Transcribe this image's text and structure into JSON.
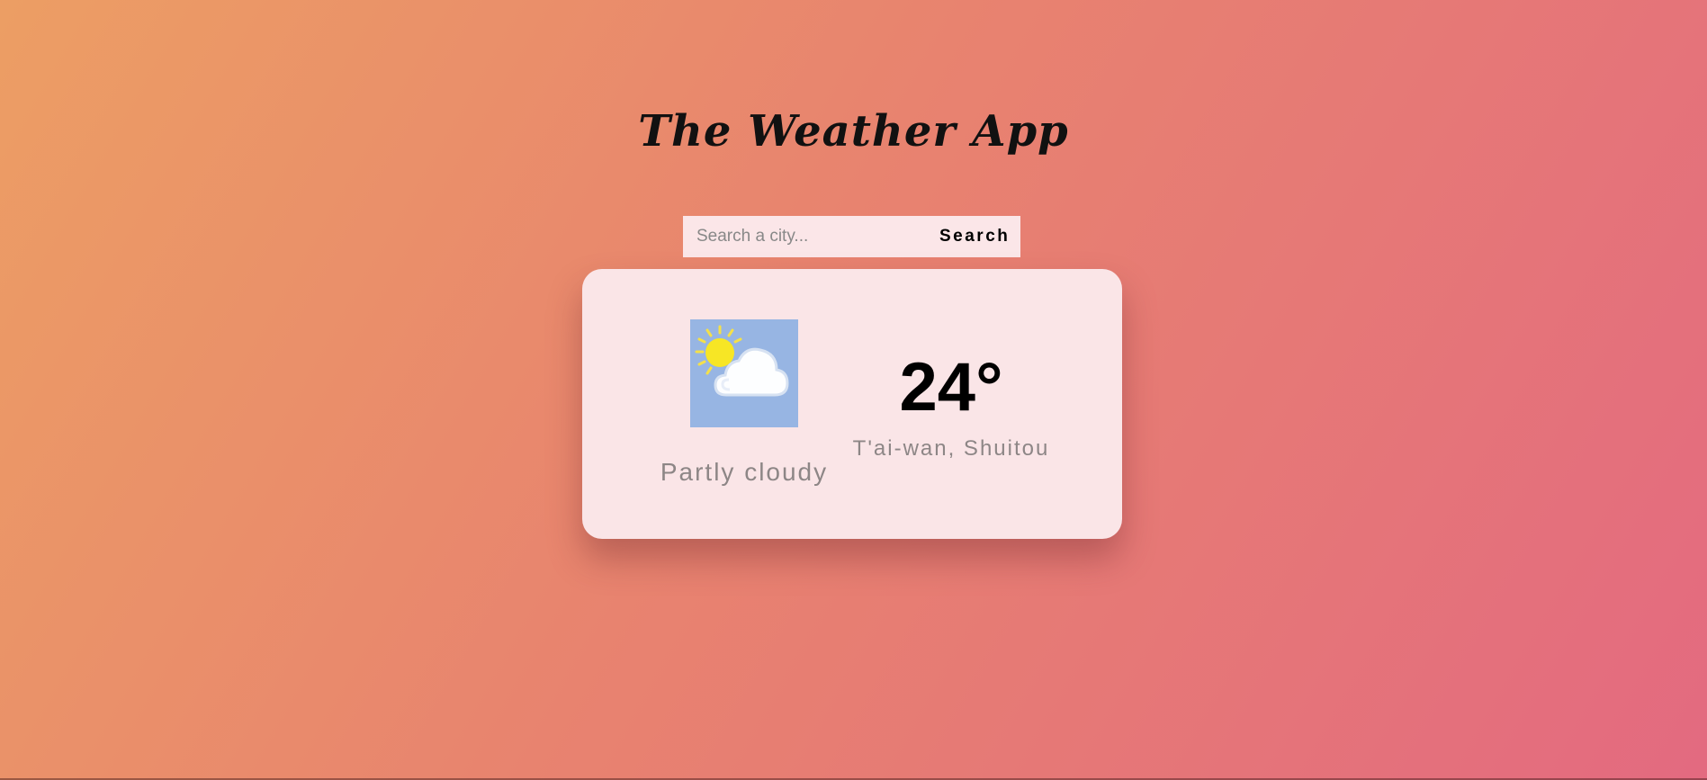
{
  "app": {
    "title": "The Weather App"
  },
  "search": {
    "placeholder": "Search a city...",
    "value": "",
    "button_label": "Search"
  },
  "weather": {
    "icon": "partly-cloudy-icon",
    "condition": "Partly cloudy",
    "temperature": "24°",
    "location": "T'ai-wan, Shuitou"
  },
  "colors": {
    "background_start": "#ec9e64",
    "background_end": "#e36a80",
    "card": "#fae5e7",
    "icon_background": "#97b5e3",
    "secondary_text": "#8d8686"
  }
}
